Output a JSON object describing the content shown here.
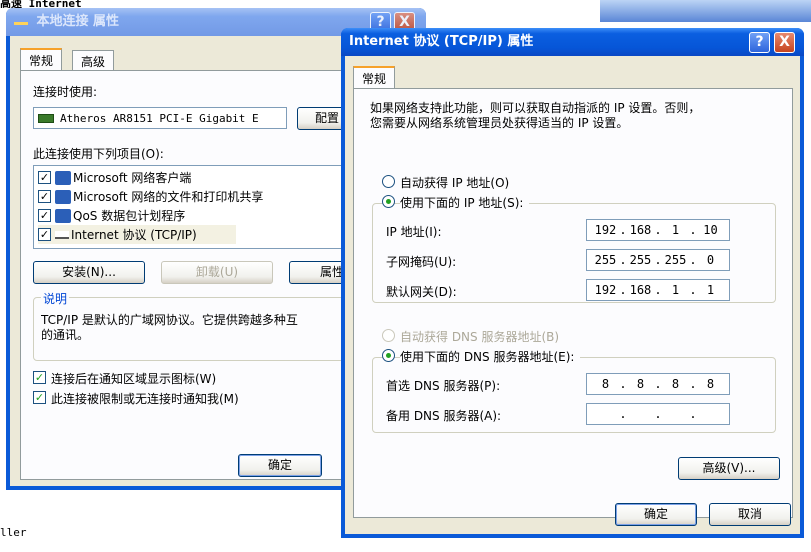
{
  "background": {
    "top_left_text": "高速 Internet",
    "bottom_left_text": "ller"
  },
  "win1": {
    "title": "本地连接 属性",
    "tabs": [
      "常规",
      "高级"
    ],
    "connect_using_label": "连接时使用:",
    "adapter_name": "Atheros AR8151 PCI-E Gigabit E",
    "configure_button": "配置",
    "items_label": "此连接使用下列项目(O):",
    "items": [
      "Microsoft 网络客户端",
      "Microsoft 网络的文件和打印机共享",
      "QoS 数据包计划程序",
      "Internet 协议 (TCP/IP)"
    ],
    "install_button": "安装(N)...",
    "uninstall_button": "卸载(U)",
    "properties_button": "属性",
    "description_label": "说明",
    "description_text_1": "TCP/IP 是默认的广域网协议。它提供跨越多种互",
    "description_text_2": "的通讯。",
    "checkbox_show_icon": "连接后在通知区域显示图标(W)",
    "checkbox_notify": "此连接被限制或无连接时通知我(M)",
    "ok_button": "确定"
  },
  "win2": {
    "title": "Internet 协议 (TCP/IP) 属性",
    "tab": "常规",
    "intro_line_1": "如果网络支持此功能，则可以获取自动指派的 IP 设置。否则，",
    "intro_line_2": "您需要从网络系统管理员处获得适当的 IP 设置。",
    "radio_auto_ip": "自动获得 IP 地址(O)",
    "radio_manual_ip": "使用下面的 IP 地址(S):",
    "ip_label": "IP 地址(I):",
    "ip_value": [
      "192",
      "168",
      "1",
      "10"
    ],
    "mask_label": "子网掩码(U):",
    "mask_value": [
      "255",
      "255",
      "255",
      "0"
    ],
    "gateway_label": "默认网关(D):",
    "gateway_value": [
      "192",
      "168",
      "1",
      "1"
    ],
    "radio_auto_dns": "自动获得 DNS 服务器地址(B)",
    "radio_manual_dns": "使用下面的 DNS 服务器地址(E):",
    "dns1_label": "首选 DNS 服务器(P):",
    "dns1_value": [
      "8",
      "8",
      "8",
      "8"
    ],
    "dns2_label": "备用 DNS 服务器(A):",
    "dns2_value": [
      "",
      "",
      "",
      ""
    ],
    "advanced_button": "高级(V)...",
    "ok_button": "确定",
    "cancel_button": "取消",
    "help_glyph": "?",
    "close_glyph": "X"
  }
}
